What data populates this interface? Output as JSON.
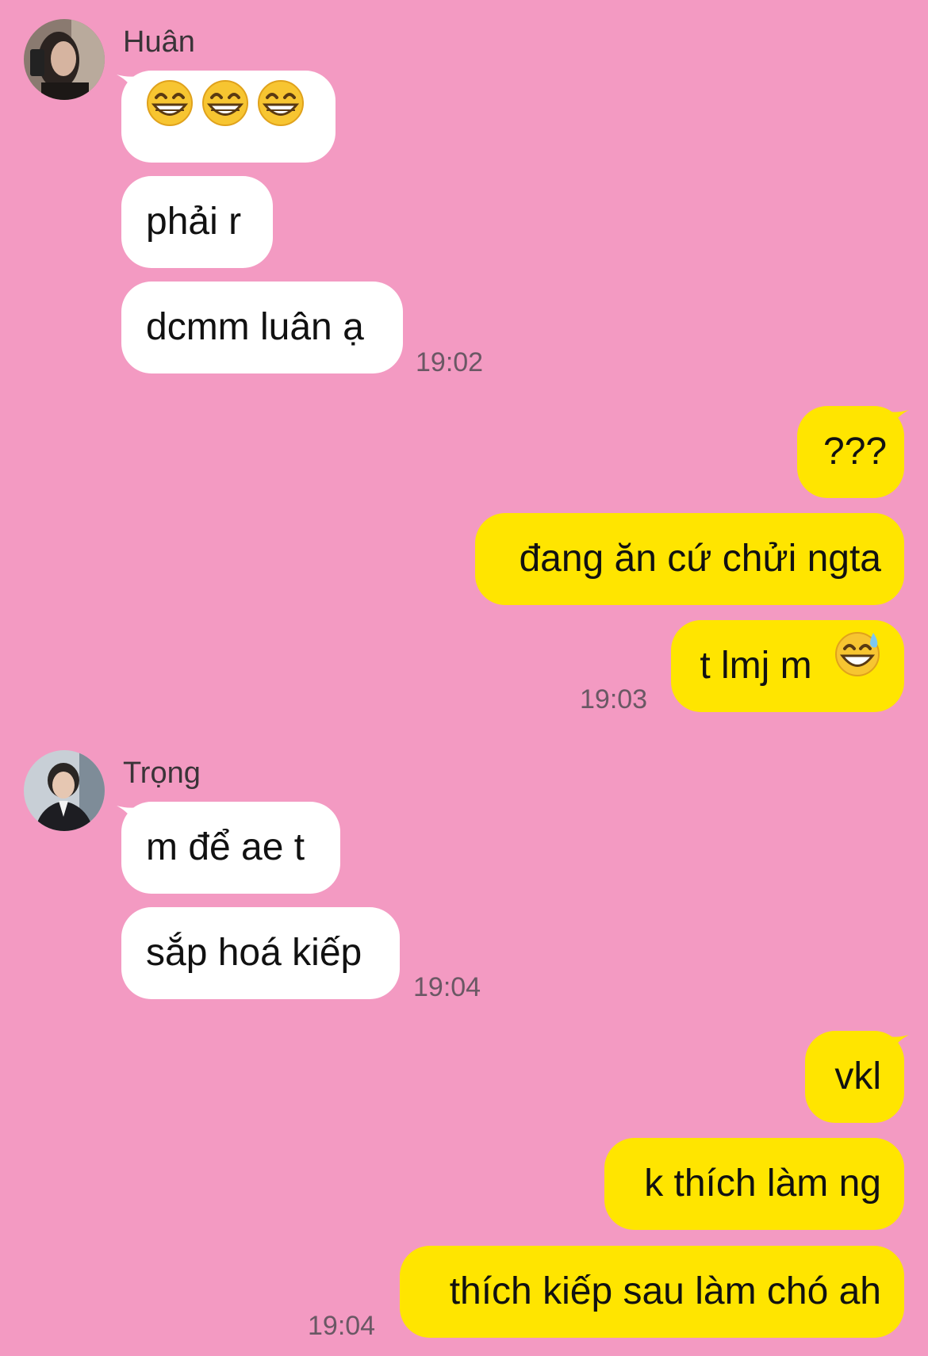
{
  "colors": {
    "background": "#f39ac2",
    "incoming_bubble": "#ffffff",
    "outgoing_bubble": "#ffe500",
    "timestamp": "#6a5864"
  },
  "groups": [
    {
      "sender": "Huân",
      "avatar_icon": "avatar-photo-huan",
      "messages": [
        "😁😁😁",
        "phải r",
        "dcmm luân ạ"
      ],
      "time": "19:02"
    },
    {
      "direction": "outgoing",
      "messages": [
        "???",
        "đang ăn cứ chửi ngta",
        "t lmj m 😅"
      ],
      "time": "19:03"
    },
    {
      "sender": "Trọng",
      "avatar_icon": "avatar-photo-trong",
      "messages": [
        "m để ae t",
        "sắp hoá kiếp"
      ],
      "time": "19:04"
    },
    {
      "direction": "outgoing",
      "messages": [
        "vkl",
        "k thích làm ng",
        "thích kiếp sau làm chó ah"
      ],
      "time": "19:04"
    }
  ]
}
